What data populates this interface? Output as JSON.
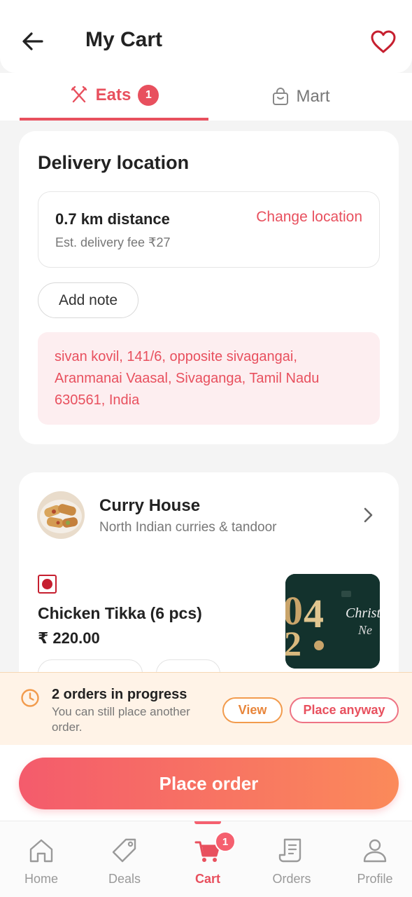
{
  "header": {
    "title": "My Cart",
    "back_icon": "arrow-left-icon",
    "favorite_icon": "heart-outline-icon"
  },
  "tabs": [
    {
      "label": "Eats",
      "badge": "1",
      "icon": "utensils-icon",
      "active": true
    },
    {
      "label": "Mart",
      "icon": "shopping-bag-icon",
      "active": false
    }
  ],
  "delivery": {
    "title": "Delivery location",
    "distance": "0.7 km distance",
    "fee": "Est. delivery fee ₹27",
    "change_label": "Change location",
    "add_note_label": "Add note",
    "address": "sivan kovil, 141/6, opposite sivagangai, Aranmanai Vaasal, Sivaganga, Tamil Nadu 630561, India"
  },
  "restaurant": {
    "name": "Curry House",
    "subtitle": "North Indian curries & tandoor",
    "item": {
      "name": "Chicken Tikka (6 pcs)",
      "price": "₹ 220.00"
    }
  },
  "orders_banner": {
    "title": "2 orders in progress",
    "subtitle": "You can still place another order.",
    "view_label": "View",
    "anyway_label": "Place anyway"
  },
  "cta": {
    "label": "Place order"
  },
  "nav": {
    "items": [
      {
        "label": "Home",
        "icon": "home-icon"
      },
      {
        "label": "Deals",
        "icon": "tag-icon"
      },
      {
        "label": "Cart",
        "icon": "cart-icon",
        "badge": "1",
        "active": true
      },
      {
        "label": "Orders",
        "icon": "receipt-icon"
      },
      {
        "label": "Profile",
        "icon": "user-icon"
      }
    ]
  },
  "colors": {
    "accent": "#e8505e",
    "cta_start": "#f45b6c",
    "cta_end": "#fb8a5a",
    "warning": "#f29b4d"
  }
}
